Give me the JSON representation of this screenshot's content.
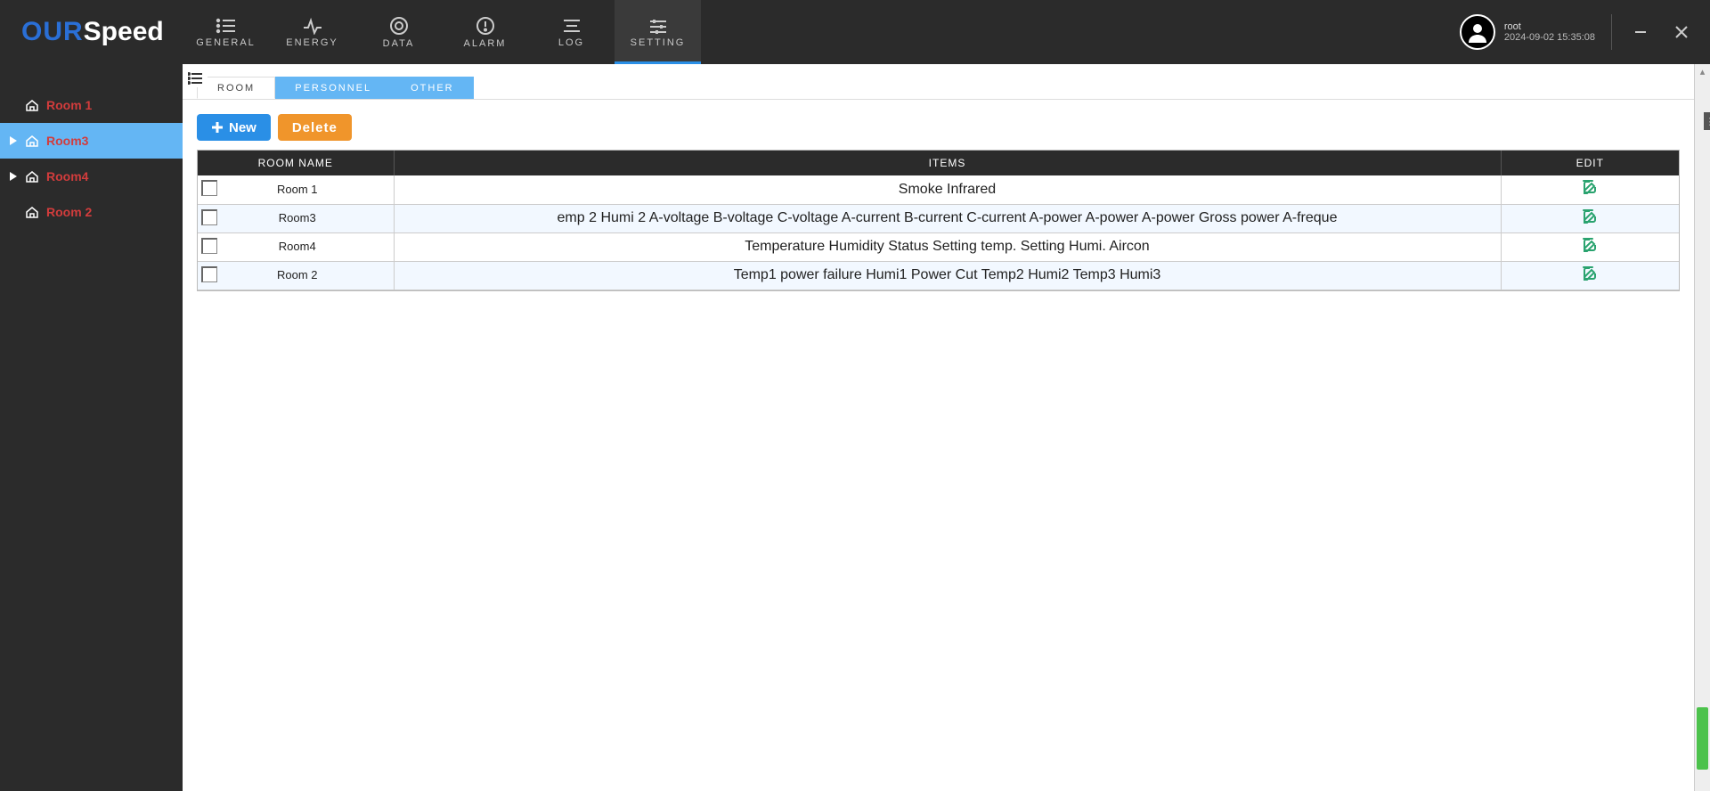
{
  "brand": {
    "part1": "OUR",
    "part2": "Speed"
  },
  "nav": {
    "general": "GENERAL",
    "energy": "ENERGY",
    "data": "DATA",
    "alarm": "ALARM",
    "log": "LOG",
    "setting": "SETTING"
  },
  "user": {
    "name": "root",
    "timestamp": "2024-09-02 15:35:08"
  },
  "sidebar": {
    "items": [
      {
        "label": "Room 1",
        "selected": false,
        "hasCaret": false
      },
      {
        "label": "Room3",
        "selected": true,
        "hasCaret": true
      },
      {
        "label": "Room4",
        "selected": false,
        "hasCaret": true
      },
      {
        "label": "Room 2",
        "selected": false,
        "hasCaret": false
      }
    ]
  },
  "tabs": {
    "room": "ROOM",
    "personnel": "PERSONNEL",
    "other": "OTHER"
  },
  "buttons": {
    "new": "New",
    "delete": "Delete"
  },
  "table": {
    "headers": {
      "room": "ROOM NAME",
      "items": "ITEMS",
      "edit": "EDIT"
    },
    "rows": [
      {
        "room": "Room 1",
        "items": "Smoke Infrared"
      },
      {
        "room": "Room3",
        "items": "emp 2 Humi 2 A-voltage B-voltage C-voltage A-current B-current C-current A-power A-power A-power Gross power A-freque"
      },
      {
        "room": "Room4",
        "items": "Temperature Humidity Status Setting temp. Setting Humi. Aircon"
      },
      {
        "room": "Room 2",
        "items": "Temp1 power failure Humi1 Power Cut  Temp2 Humi2 Temp3 Humi3"
      }
    ]
  }
}
